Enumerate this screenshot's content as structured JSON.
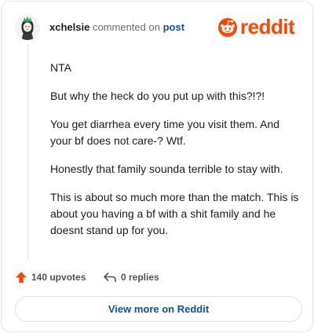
{
  "header": {
    "username": "xchelsie",
    "action_text": "commented on",
    "post_link": "post",
    "brand": "reddit"
  },
  "comment": {
    "paragraphs": [
      "NTA",
      "But why the heck do you put up with this?!?!",
      "You get diarrhea every time you visit them. And your bf does not care-? Wtf.",
      "Honestly that family sounda terrible to stay with.",
      "This is about so much more than the match. This is about you having a bf with a shit family and he doesnt stand up for you."
    ]
  },
  "footer": {
    "upvotes": "140 upvotes",
    "replies": "0 replies",
    "view_more": "View more on Reddit"
  },
  "colors": {
    "brand": "#ff4500",
    "link": "#0f4fa8",
    "avatar_accent": "#2bb07a"
  },
  "icons": [
    "avatar",
    "reddit-logo-icon",
    "upvote-arrow-icon",
    "reply-arrow-icon"
  ]
}
